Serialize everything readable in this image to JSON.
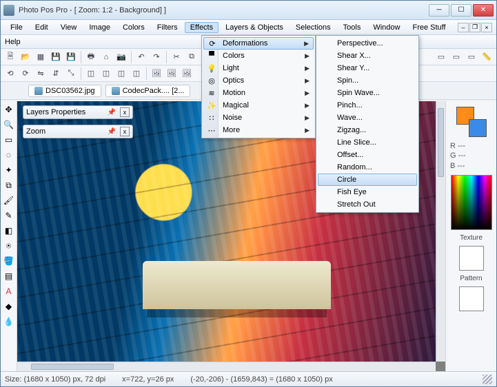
{
  "window_title": "Photo Pos Pro - [ Zoom: 1:2 - Background]              ]",
  "menus": {
    "file": "File",
    "edit": "Edit",
    "view": "View",
    "image": "Image",
    "colors": "Colors",
    "filters": "Filters",
    "effects": "Effects",
    "layers": "Layers & Objects",
    "selections": "Selections",
    "tools": "Tools",
    "window": "Window",
    "free": "Free Stuff",
    "help": "Help"
  },
  "tabs": [
    "DSC03562.jpg",
    "CodecPack.... [2..."
  ],
  "floating": {
    "layers": "Layers Properties",
    "zoom": "Zoom"
  },
  "effects_menu": [
    {
      "label": "Deformations",
      "sub": true
    },
    {
      "label": "Colors",
      "sub": true
    },
    {
      "label": "Light",
      "sub": true
    },
    {
      "label": "Optics",
      "sub": true
    },
    {
      "label": "Motion",
      "sub": true
    },
    {
      "label": "Magical",
      "sub": true
    },
    {
      "label": "Noise",
      "sub": true
    },
    {
      "label": "More",
      "sub": true
    }
  ],
  "deform_menu": [
    "Perspective...",
    "Shear X...",
    "Shear Y...",
    "Spin...",
    "Spin Wave...",
    "Pinch...",
    "Wave...",
    "Zigzag...",
    "Line Slice...",
    "Offset...",
    "Random...",
    "Circle",
    "Fish Eye",
    "Stretch Out"
  ],
  "deform_highlight": "Circle",
  "rgb": {
    "r": "R ---",
    "g": "G ---",
    "b": "B ---"
  },
  "right_labels": {
    "texture": "Texture",
    "pattern": "Pattern"
  },
  "status": {
    "size": "Size: (1680 x 1050) px, 72 dpi",
    "pos": "x=722, y=26 px",
    "sel": "(-20,-206) - (1659,843) = (1680 x 1050) px"
  },
  "colors": {
    "fg": "#ff8c1a",
    "bg": "#3b8be6"
  }
}
